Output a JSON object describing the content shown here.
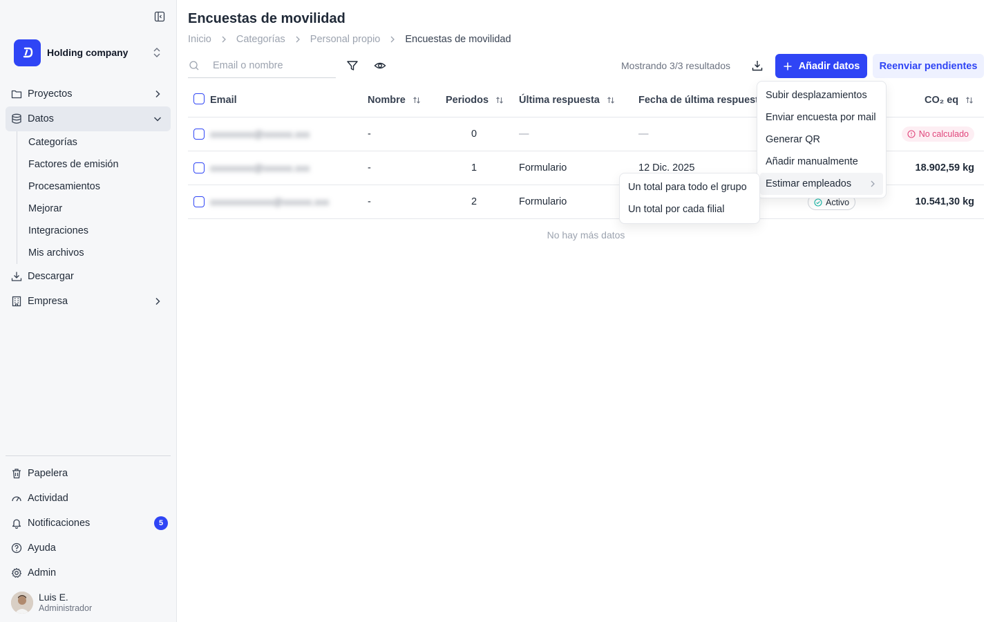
{
  "sidebar": {
    "company_name": "Holding company",
    "nav": [
      {
        "label": "Proyectos",
        "icon": "folder-icon"
      },
      {
        "label": "Datos",
        "icon": "database-icon"
      },
      {
        "label": "Descargar",
        "icon": "download-icon"
      },
      {
        "label": "Empresa",
        "icon": "building-icon"
      }
    ],
    "datos_sub": [
      "Categorías",
      "Factores de emisión",
      "Procesamientos",
      "Mejorar",
      "Integraciones",
      "Mis archivos"
    ],
    "bottom": [
      {
        "label": "Papelera",
        "icon": "trash-icon"
      },
      {
        "label": "Actividad",
        "icon": "activity-icon"
      },
      {
        "label": "Notificaciones",
        "icon": "bell-icon",
        "badge": "5"
      },
      {
        "label": "Ayuda",
        "icon": "help-icon"
      },
      {
        "label": "Admin",
        "icon": "gear-icon"
      }
    ],
    "user": {
      "name": "Luis E.",
      "role": "Administrador"
    }
  },
  "header": {
    "title": "Encuestas de movilidad",
    "breadcrumb": [
      "Inicio",
      "Categorías",
      "Personal propio",
      "Encuestas de movilidad"
    ]
  },
  "toolbar": {
    "search_placeholder": "Email o nombre",
    "results": "Mostrando 3/3 resultados",
    "add_label": "Añadir datos",
    "resend_label": "Reenviar pendientes"
  },
  "table": {
    "headers": {
      "email": "Email",
      "nombre": "Nombre",
      "periodos": "Periodos",
      "ultima": "Última respuesta",
      "fecha": "Fecha de última respuesta",
      "co2": "CO₂ eq"
    },
    "rows": [
      {
        "email": "xxxxxxxxx@xxxxxx.xxx",
        "nombre": "-",
        "periodos": "0",
        "ultima": "—",
        "fecha": "—",
        "status": "No calculado",
        "co2": ""
      },
      {
        "email": "xxxxxxxxx@xxxxxx.xxx",
        "nombre": "-",
        "periodos": "1",
        "ultima": "Formulario",
        "fecha": "12 Dic. 2025",
        "status": "",
        "co2": "18.902,59 kg"
      },
      {
        "email": "xxxxxxxxxxxxx@xxxxxx.xxx",
        "nombre": "-",
        "periodos": "2",
        "ultima": "Formulario",
        "fecha": "",
        "status": "Activo",
        "co2": "10.541,30 kg"
      }
    ],
    "empty_text": "No hay más datos"
  },
  "add_menu": {
    "items": [
      "Subir desplazamientos",
      "Enviar encuesta por mail",
      "Generar QR",
      "Añadir manualmente",
      "Estimar empleados"
    ]
  },
  "estimate_submenu": {
    "items": [
      "Un total para todo el grupo",
      "Un total por cada filial"
    ]
  },
  "colors": {
    "accent": "#2f45f5",
    "status_not_calculated": "#e0457b",
    "status_active": "#14b8a6"
  }
}
